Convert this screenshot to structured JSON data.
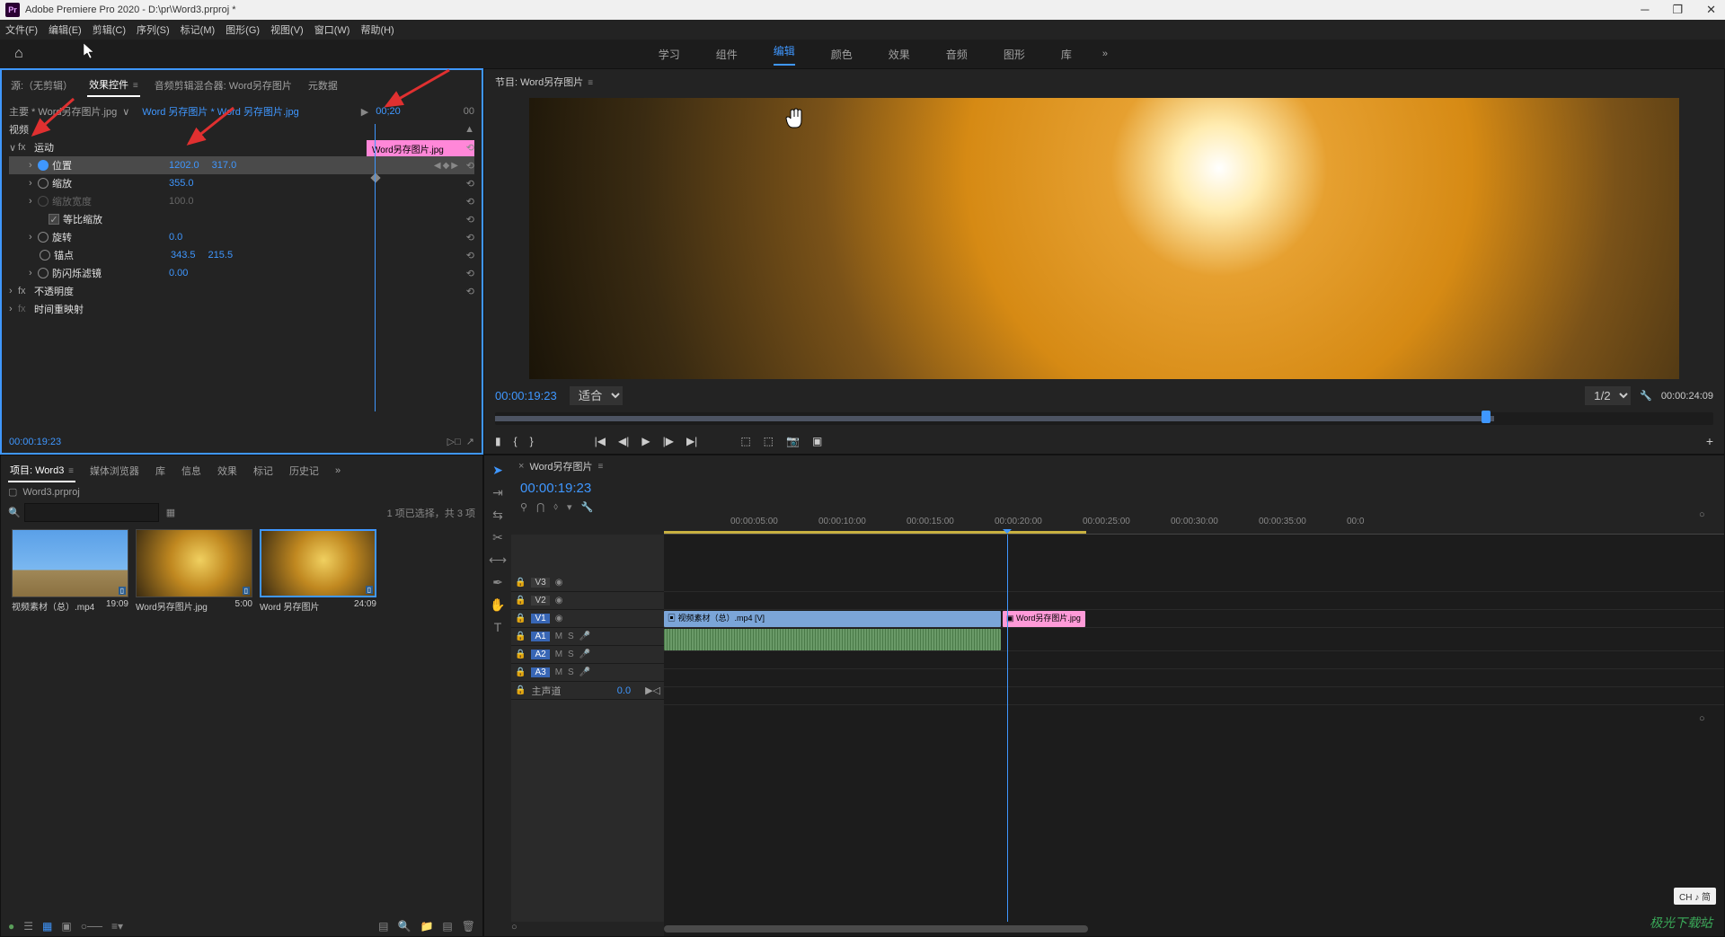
{
  "title_bar": {
    "app_name": "Adobe Premiere Pro 2020",
    "file_path": "D:\\pr\\Word3.prproj *",
    "icon_label": "Pr"
  },
  "window_controls": {
    "minimize": "─",
    "maximize": "❐",
    "close": "✕"
  },
  "menu": [
    "文件(F)",
    "编辑(E)",
    "剪辑(C)",
    "序列(S)",
    "标记(M)",
    "图形(G)",
    "视图(V)",
    "窗口(W)",
    "帮助(H)"
  ],
  "workspaces": {
    "tabs": [
      "学习",
      "组件",
      "编辑",
      "颜色",
      "效果",
      "音频",
      "图形",
      "库"
    ],
    "active": "编辑",
    "more": "»"
  },
  "effect_controls": {
    "tabs": [
      "源:（无剪辑）",
      "效果控件",
      "音频剪辑混合器: Word另存图片",
      "元数据"
    ],
    "active_tab": "效果控件",
    "master_clip": "主要 * Word另存图片.jpg",
    "clip_chain": "Word 另存图片 * Word 另存图片.jpg",
    "playhead_time": "00;20",
    "right_tc": "00",
    "track_label": "Word另存图片.jpg",
    "section_video": "视频",
    "sections": {
      "motion": {
        "label": "运动",
        "position": {
          "label": "位置",
          "x": "1202.0",
          "y": "317.0"
        },
        "scale": {
          "label": "缩放",
          "value": "355.0"
        },
        "scale_width": {
          "label": "缩放宽度",
          "value": "100.0"
        },
        "uniform": {
          "label": "等比缩放",
          "checked": true
        },
        "rotation": {
          "label": "旋转",
          "value": "0.0"
        },
        "anchor": {
          "label": "锚点",
          "x": "343.5",
          "y": "215.5"
        },
        "antiflicker": {
          "label": "防闪烁滤镜",
          "value": "0.00"
        }
      },
      "opacity": {
        "label": "不透明度"
      },
      "time_remap": {
        "label": "时间重映射"
      }
    },
    "footer_tc": "00:00:19:23"
  },
  "program_monitor": {
    "title": "节目: Word另存图片",
    "tc": "00:00:19:23",
    "fit_label": "适合",
    "res_label": "1/2",
    "duration": "00:00:24:09"
  },
  "project_panel": {
    "tabs": [
      "项目: Word3",
      "媒体浏览器",
      "库",
      "信息",
      "效果",
      "标记",
      "历史记",
      "»"
    ],
    "active_tab": "项目: Word3",
    "project_file": "Word3.prproj",
    "selection_text": "1 项已选择，共 3 项",
    "search_placeholder": "",
    "items": [
      {
        "name": "视频素材（总）.mp4",
        "duration": "19:09"
      },
      {
        "name": "Word另存图片.jpg",
        "duration": "5:00"
      },
      {
        "name": "Word 另存图片",
        "duration": "24:09"
      }
    ]
  },
  "timeline": {
    "seq_name": "Word另存图片",
    "tc": "00:00:19:23",
    "ruler": [
      "",
      "00:00:05:00",
      "00:00:10:00",
      "00:00:15:00",
      "00:00:20:00",
      "00:00:25:00",
      "00:00:30:00",
      "00:00:35:00",
      "00:0"
    ],
    "tracks": {
      "video": [
        "V3",
        "V2",
        "V1"
      ],
      "audio": [
        "A1",
        "A2",
        "A3"
      ],
      "master": "主声道",
      "master_value": "0.0"
    },
    "clips": {
      "v1_main": "视频素材（总）.mp4 [V]",
      "v1_pink": "Word另存图片.jpg"
    },
    "toggles": {
      "m": "M",
      "s": "S",
      "eye": "◉"
    }
  },
  "ch_badge": "CH ♪ 简",
  "watermark": "极光下载站"
}
